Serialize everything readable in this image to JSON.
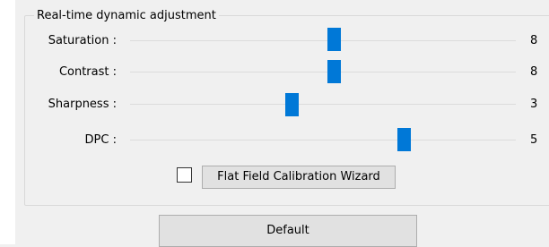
{
  "panel": {
    "title": "Real-time dynamic adjustment"
  },
  "sliders": [
    {
      "label": "Saturation :",
      "value": "8",
      "level": 0.53
    },
    {
      "label": "Contrast :",
      "value": "8",
      "level": 0.53
    },
    {
      "label": "Sharpness :",
      "value": "3",
      "level": 0.42
    },
    {
      "label": "DPC :",
      "value": "5",
      "level": 0.71
    }
  ],
  "checkbox": {
    "checked": false
  },
  "wizard_button": {
    "label": "Flat Field Calibration Wizard"
  },
  "default_button": {
    "label": "Default"
  },
  "colors": {
    "thumb": "#0078d7",
    "track": "#dcdcdc",
    "background": "#f0f0f0",
    "button_face": "#e1e1e1"
  }
}
